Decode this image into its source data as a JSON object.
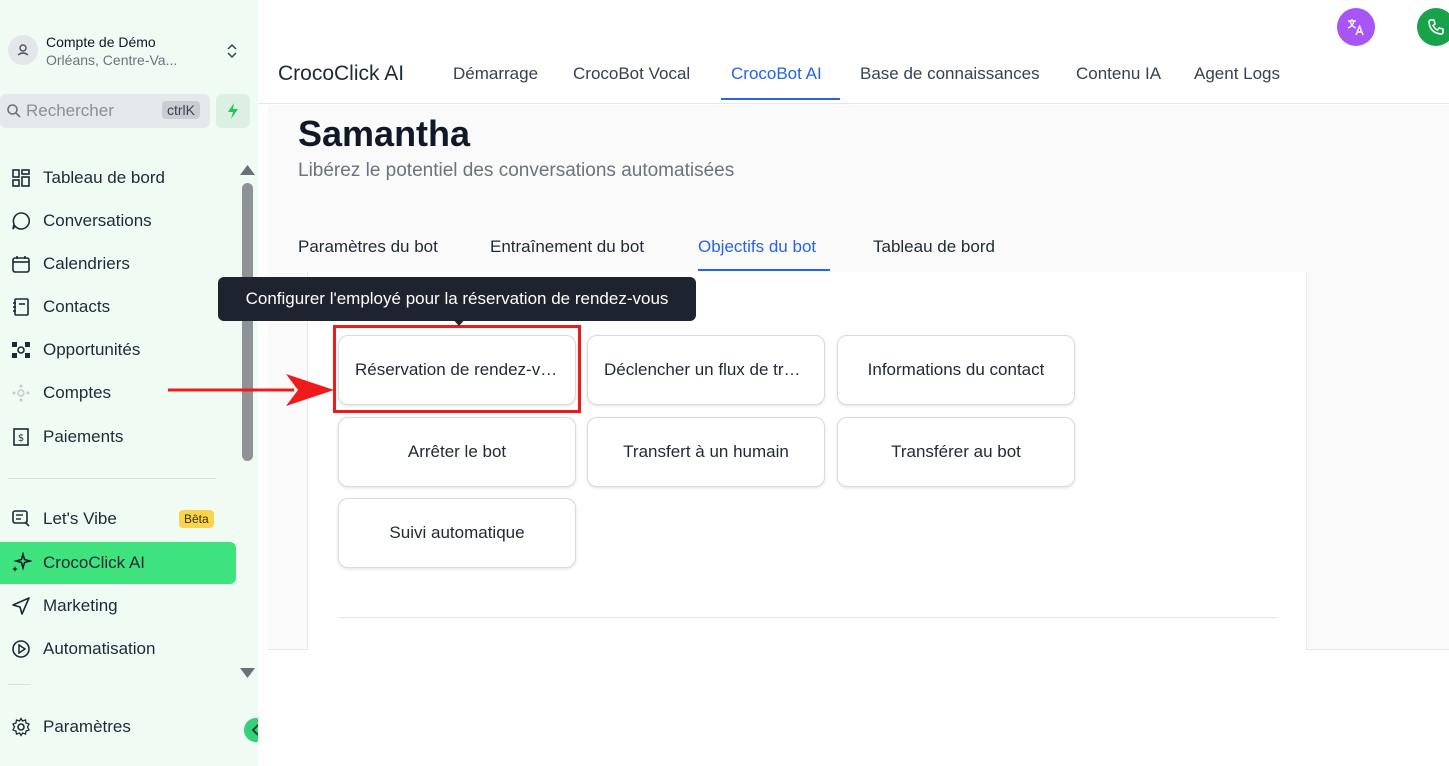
{
  "account": {
    "name": "Compte de Démo",
    "location": "Orléans, Centre-Va..."
  },
  "search": {
    "placeholder": "Rechercher",
    "shortcut": "ctrlK"
  },
  "sidebar": {
    "items": [
      {
        "label": "Tableau de bord",
        "icon": "dashboard-icon"
      },
      {
        "label": "Conversations",
        "icon": "chat-bubble-icon"
      },
      {
        "label": "Calendriers",
        "icon": "calendar-icon"
      },
      {
        "label": "Contacts",
        "icon": "contact-book-icon"
      },
      {
        "label": "Opportunités",
        "icon": "pipeline-icon"
      },
      {
        "label": "Comptes",
        "icon": "accounts-icon"
      },
      {
        "label": "Paiements",
        "icon": "payments-icon"
      },
      {
        "label": "Let's Vibe",
        "icon": "vibe-icon",
        "badge": "Bêta"
      },
      {
        "label": "CrocoClick AI",
        "icon": "sparkle-icon"
      },
      {
        "label": "Marketing",
        "icon": "send-icon"
      },
      {
        "label": "Automatisation",
        "icon": "automation-icon"
      }
    ],
    "settings_label": "Paramètres"
  },
  "topbar": {
    "brand": "CrocoClick AI",
    "tabs": [
      "Démarrage",
      "CrocoBot Vocal",
      "CrocoBot AI",
      "Base de connaissances",
      "Contenu IA",
      "Agent Logs"
    ],
    "active_tab": "CrocoBot AI"
  },
  "page": {
    "title": "Samantha",
    "subtitle": "Libérez le potentiel des conversations automatisées",
    "tabs": [
      "Paramètres du bot",
      "Entraînement du bot",
      "Objectifs du bot",
      "Tableau de bord"
    ],
    "active_tab": "Objectifs du bot"
  },
  "goals": [
    "Réservation de rendez-vous",
    "Déclencher un flux de travail",
    "Informations du contact",
    "Arrêter le bot",
    "Transfert à un humain",
    "Transférer au bot",
    "Suivi automatique"
  ],
  "tooltip": "Configurer l'employé pour la réservation de rendez-vous",
  "colors": {
    "accent_green": "#3ee37e",
    "link_blue": "#2563eb",
    "highlight_red": "#ef1b1b",
    "lang_purple": "#a855f7",
    "phone_green": "#16a34a"
  }
}
